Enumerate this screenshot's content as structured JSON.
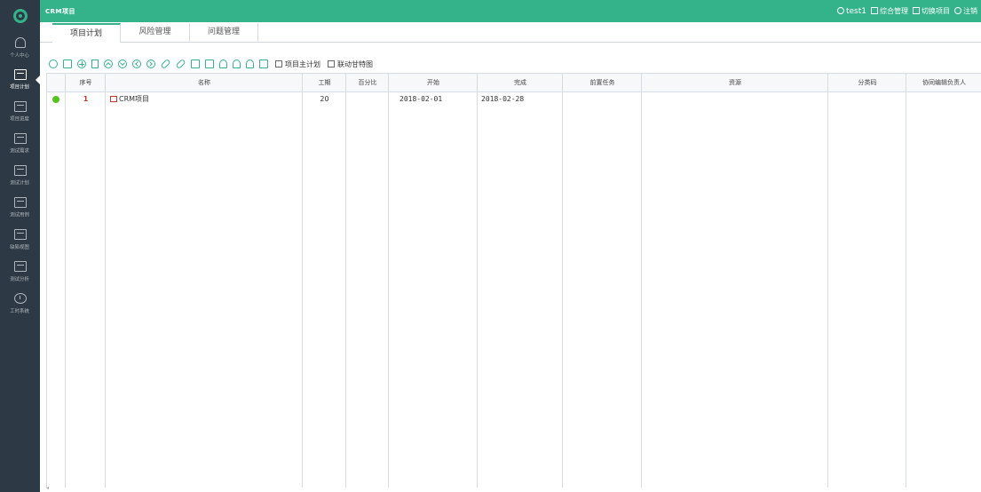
{
  "app": {
    "title": "CRM项目"
  },
  "topbar": {
    "user": "test1",
    "links": [
      "综合管理",
      "切换项目",
      "注销"
    ]
  },
  "sidebar": {
    "items": [
      {
        "label": "个人中心",
        "icon": "user-icon"
      },
      {
        "label": "项目计划",
        "icon": "plan-icon",
        "active": true
      },
      {
        "label": "项目进度",
        "icon": "progress-icon"
      },
      {
        "label": "测试需求",
        "icon": "requirement-icon"
      },
      {
        "label": "测试计划",
        "icon": "test-plan-icon"
      },
      {
        "label": "测试用例",
        "icon": "test-case-icon"
      },
      {
        "label": "缺陷视图",
        "icon": "defect-view-icon"
      },
      {
        "label": "测试分析",
        "icon": "analysis-icon"
      },
      {
        "label": "工时系统",
        "icon": "clock-icon"
      }
    ]
  },
  "tabs": [
    {
      "label": "项目计划",
      "active": true
    },
    {
      "label": "风险管理",
      "active": false
    },
    {
      "label": "问题管理",
      "active": false
    }
  ],
  "toolbar": {
    "checkbox_1": "项目主计划",
    "checkbox_2": "联动甘特图"
  },
  "table": {
    "headers": [
      "序号",
      "名称",
      "工期",
      "百分比",
      "开始",
      "完成",
      "前置任务",
      "资源",
      "分类码",
      "协同编辑负责人"
    ],
    "rows": [
      {
        "index": "1",
        "name": "CRM项目",
        "duration": "20",
        "percent": "",
        "start": "2018-02-01",
        "finish": "2018-02-28",
        "predecessor": "",
        "resource": "",
        "code": "",
        "owner": "",
        "status": "green"
      }
    ]
  },
  "colors": {
    "brand": "#34b28a",
    "sidebar": "#2d3a45",
    "status_ok": "#52c41a",
    "row_number": "#c0392b"
  }
}
